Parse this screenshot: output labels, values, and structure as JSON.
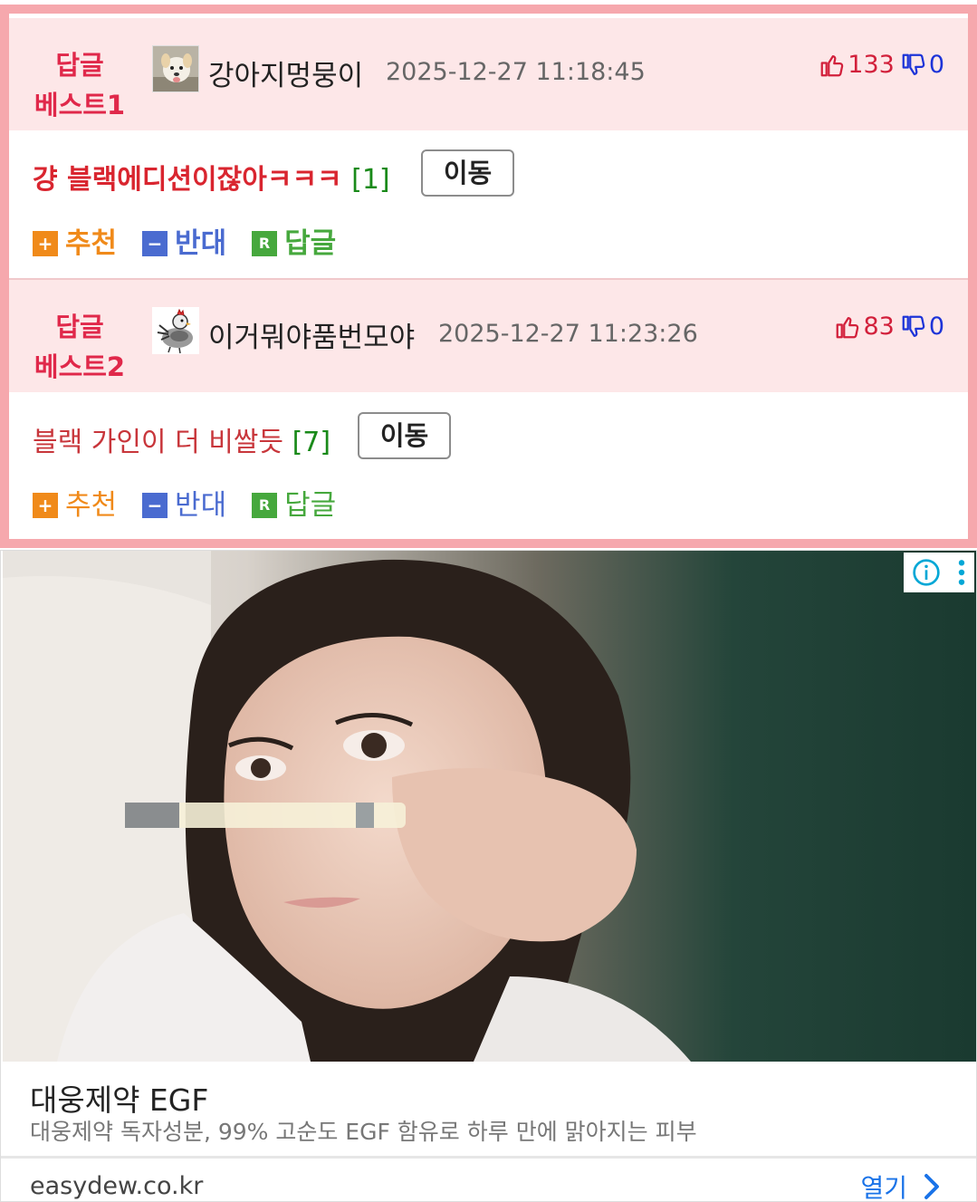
{
  "comments": [
    {
      "badge_line1": "답글",
      "badge_line2": "베스트1",
      "nickname": "강아지멍뭉이",
      "date": "2025-12-27 11:18:45",
      "up": "133",
      "down": "0",
      "text": "걍 블랙에디션이잖아ㅋㅋㅋ",
      "reply_count": "[1]",
      "move_label": "이동",
      "recommend": "추천",
      "oppose": "반대",
      "reply": "답글"
    },
    {
      "badge_line1": "답글",
      "badge_line2": "베스트2",
      "nickname": "이거뭐야품번모야",
      "date": "2025-12-27 11:23:26",
      "up": "83",
      "down": "0",
      "text": "블랙 가인이 더 비쌀듯",
      "reply_count": "[7]",
      "move_label": "이동",
      "recommend": "추천",
      "oppose": "반대",
      "reply": "답글"
    }
  ],
  "ad": {
    "title": "대웅제약 EGF",
    "description": "대웅제약 독자성분, 99% 고순도 EGF 함유로 하루 만에 맑아지는 피부",
    "domain": "easydew.co.kr",
    "open_label": "열기"
  },
  "colors": {
    "badge": "#e0284a",
    "up": "#d2203b",
    "down": "#1d34d8",
    "comment_best1": "#d9252f",
    "comment_best2": "#c8363b",
    "recommend_icon": "#f08a1a",
    "oppose_icon": "#4a6bd0",
    "reply_icon": "#46a83d"
  }
}
